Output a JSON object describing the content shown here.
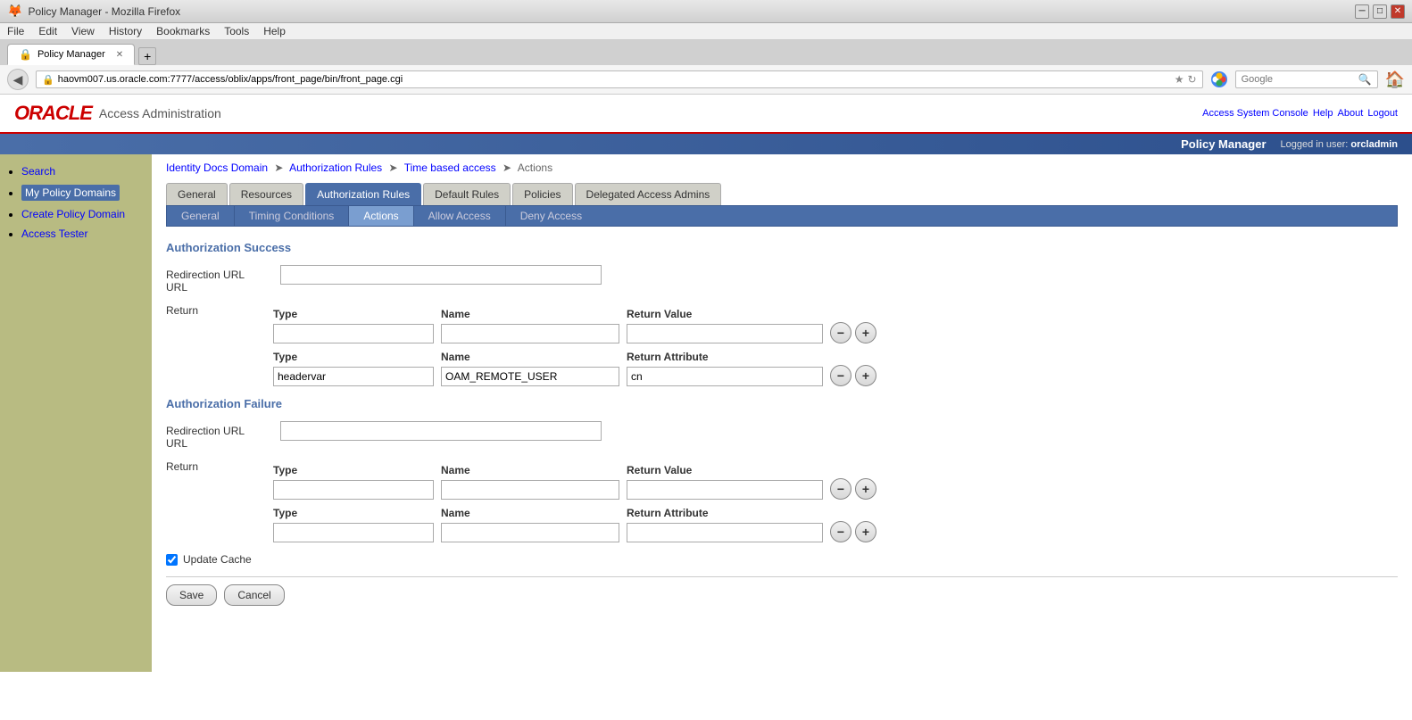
{
  "browser": {
    "title": "Policy Manager - Mozilla Firefox",
    "url": "haovm007.us.oracle.com:7777/access/oblix/apps/front_page/bin/front_page.cgi",
    "tab_label": "Policy Manager",
    "search_placeholder": "Google",
    "menu_items": [
      "File",
      "Edit",
      "View",
      "History",
      "Bookmarks",
      "Tools",
      "Help"
    ]
  },
  "oracle": {
    "logo_text": "ORACLE",
    "app_name": "Access Administration",
    "top_links": [
      "Access System Console",
      "Help",
      "About",
      "Logout"
    ],
    "policy_manager_label": "Policy Manager",
    "logged_in_prefix": "Logged in user:",
    "username": "orcladmin"
  },
  "sidebar": {
    "items": [
      {
        "label": "Search",
        "active": false
      },
      {
        "label": "My Policy Domains",
        "active": true
      },
      {
        "label": "Create Policy Domain",
        "active": false
      },
      {
        "label": "Access Tester",
        "active": false
      }
    ]
  },
  "breadcrumb": {
    "items": [
      {
        "label": "Identity Docs Domain",
        "link": true
      },
      {
        "label": "Authorization Rules",
        "link": true
      },
      {
        "label": "Time based access",
        "link": true
      },
      {
        "label": "Actions",
        "link": false
      }
    ]
  },
  "main_tabs": [
    {
      "label": "General",
      "active": false
    },
    {
      "label": "Resources",
      "active": false
    },
    {
      "label": "Authorization Rules",
      "active": true
    },
    {
      "label": "Default Rules",
      "active": false
    },
    {
      "label": "Policies",
      "active": false
    },
    {
      "label": "Delegated Access Admins",
      "active": false
    }
  ],
  "sub_tabs": [
    {
      "label": "General",
      "active": false
    },
    {
      "label": "Timing Conditions",
      "active": false
    },
    {
      "label": "Actions",
      "active": true
    },
    {
      "label": "Allow Access",
      "active": false
    },
    {
      "label": "Deny Access",
      "active": false
    }
  ],
  "auth_success": {
    "heading": "Authorization Success",
    "redirection_url_label": "Redirection URL",
    "return_label": "Return",
    "type_label": "Type",
    "name_label": "Name",
    "return_value_label": "Return Value",
    "return_attribute_label": "Return Attribute",
    "row1": {
      "type_value": "",
      "name_value": "",
      "return_value": ""
    },
    "row2": {
      "type_value": "headervar",
      "name_value": "OAM_REMOTE_USER",
      "return_attribute_value": "cn"
    }
  },
  "auth_failure": {
    "heading": "Authorization Failure",
    "redirection_url_label": "Redirection URL",
    "return_label": "Return",
    "type_label": "Type",
    "name_label": "Name",
    "return_value_label": "Return Value",
    "return_attribute_label": "Return Attribute",
    "row1": {
      "type_value": "",
      "name_value": "",
      "return_value": ""
    },
    "row2": {
      "type_value": "",
      "name_value": "",
      "return_attribute_value": ""
    }
  },
  "form": {
    "update_cache_label": "Update Cache",
    "update_cache_checked": true,
    "save_label": "Save",
    "cancel_label": "Cancel"
  },
  "buttons": {
    "minus": "−",
    "plus": "+"
  }
}
